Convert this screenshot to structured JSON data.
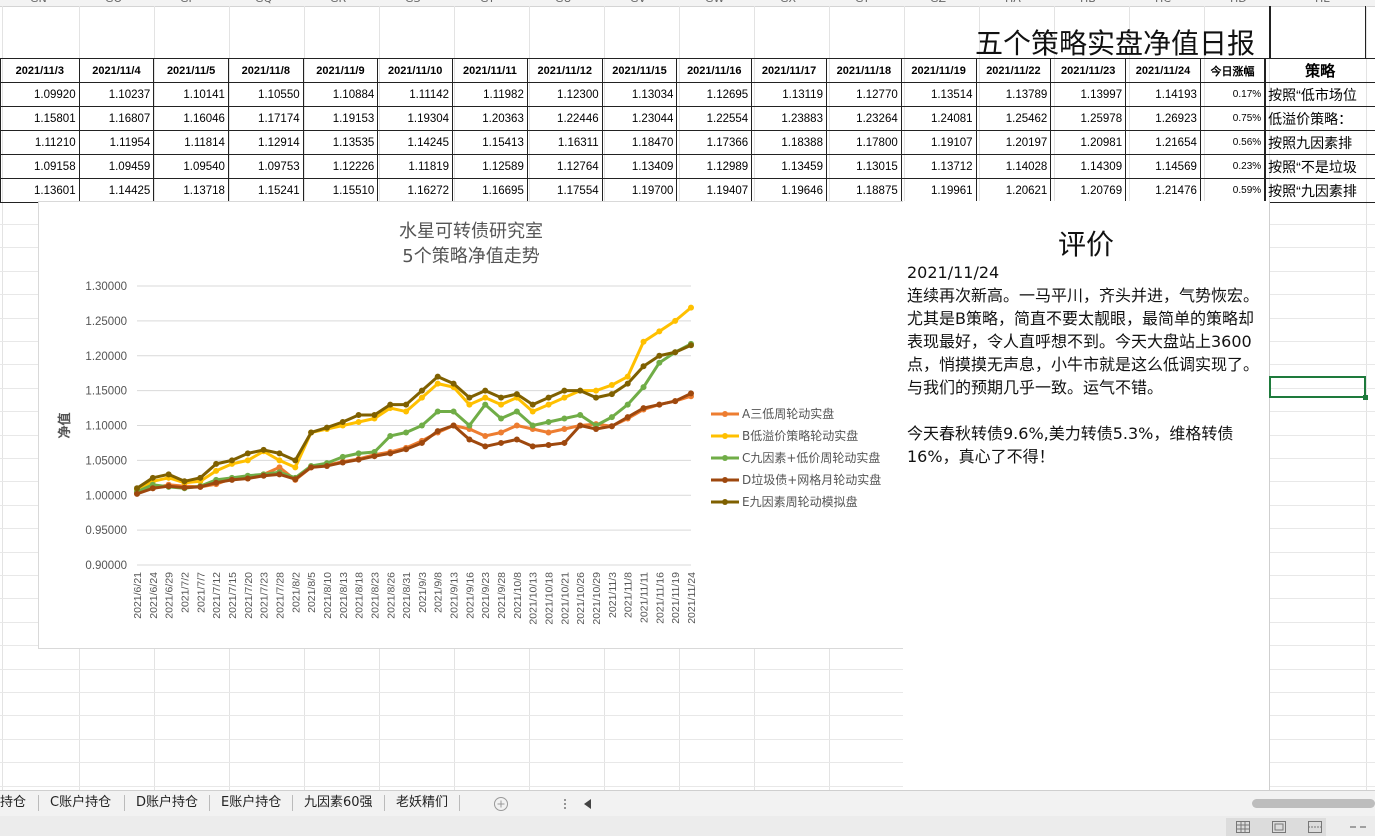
{
  "main_title": "五个策略实盘净值日报",
  "table": {
    "headers": [
      "2021/11/3",
      "2021/11/4",
      "2021/11/5",
      "2021/11/8",
      "2021/11/9",
      "2021/11/10",
      "2021/11/11",
      "2021/11/12",
      "2021/11/15",
      "2021/11/16",
      "2021/11/17",
      "2021/11/18",
      "2021/11/19",
      "2021/11/22",
      "2021/11/23",
      "2021/11/24",
      "今日涨幅",
      "策略"
    ],
    "rows": [
      [
        "1.09920",
        "1.10237",
        "1.10141",
        "1.10550",
        "1.10884",
        "1.11142",
        "1.11982",
        "1.12300",
        "1.13034",
        "1.12695",
        "1.13119",
        "1.12770",
        "1.13514",
        "1.13789",
        "1.13997",
        "1.14193",
        "0.17%",
        "按照“低市场位"
      ],
      [
        "1.15801",
        "1.16807",
        "1.16046",
        "1.17174",
        "1.19153",
        "1.19304",
        "1.20363",
        "1.22446",
        "1.23044",
        "1.22554",
        "1.23883",
        "1.23264",
        "1.24081",
        "1.25462",
        "1.25978",
        "1.26923",
        "0.75%",
        "低溢价策略："
      ],
      [
        "1.11210",
        "1.11954",
        "1.11814",
        "1.12914",
        "1.13535",
        "1.14245",
        "1.15413",
        "1.16311",
        "1.18470",
        "1.17366",
        "1.18388",
        "1.17800",
        "1.19107",
        "1.20197",
        "1.20981",
        "1.21654",
        "0.56%",
        "按照九因素排"
      ],
      [
        "1.09158",
        "1.09459",
        "1.09540",
        "1.09753",
        "1.12226",
        "1.11819",
        "1.12589",
        "1.12764",
        "1.13409",
        "1.12989",
        "1.13459",
        "1.13015",
        "1.13712",
        "1.14028",
        "1.14309",
        "1.14569",
        "0.23%",
        "按照“不是垃圾"
      ],
      [
        "1.13601",
        "1.14425",
        "1.13718",
        "1.15241",
        "1.15510",
        "1.16272",
        "1.16695",
        "1.17554",
        "1.19700",
        "1.19407",
        "1.19646",
        "1.18875",
        "1.19961",
        "1.20621",
        "1.20769",
        "1.21476",
        "0.59%",
        "按照“九因素排"
      ]
    ]
  },
  "chart_data": {
    "type": "line",
    "title": "水星可转债研究室",
    "subtitle": "5个策略净值走势",
    "ylabel": "净值",
    "ylim": [
      0.9,
      1.3
    ],
    "yticks": [
      "0.90000",
      "0.95000",
      "1.00000",
      "1.05000",
      "1.10000",
      "1.15000",
      "1.20000",
      "1.25000",
      "1.30000"
    ],
    "xtick_labels": [
      "2021/6/21",
      "2021/6/24",
      "2021/6/29",
      "2021/7/2",
      "2021/7/7",
      "2021/7/12",
      "2021/7/15",
      "2021/7/20",
      "2021/7/23",
      "2021/7/28",
      "2021/8/2",
      "2021/8/5",
      "2021/8/10",
      "2021/8/13",
      "2021/8/18",
      "2021/8/23",
      "2021/8/26",
      "2021/8/31",
      "2021/9/3",
      "2021/9/8",
      "2021/9/13",
      "2021/9/16",
      "2021/9/23",
      "2021/9/28",
      "2021/10/8",
      "2021/10/13",
      "2021/10/18",
      "2021/10/21",
      "2021/10/26",
      "2021/10/29",
      "2021/11/3",
      "2021/11/8",
      "2021/11/11",
      "2021/11/16",
      "2021/11/19",
      "2021/11/24"
    ],
    "legend_position": "right",
    "grid": true,
    "series": [
      {
        "name": "A三低周轮动实盘",
        "color": "#ed7d31",
        "values": [
          1.003,
          1.01,
          1.015,
          1.013,
          1.012,
          1.016,
          1.024,
          1.024,
          1.03,
          1.04,
          1.022,
          1.04,
          1.043,
          1.048,
          1.052,
          1.058,
          1.062,
          1.068,
          1.078,
          1.09,
          1.1,
          1.095,
          1.085,
          1.09,
          1.1,
          1.095,
          1.09,
          1.095,
          1.1,
          1.102,
          1.099,
          1.11,
          1.123,
          1.13,
          1.135,
          1.142
        ]
      },
      {
        "name": "B低溢价策略轮动实盘",
        "color": "#ffc000",
        "values": [
          1.008,
          1.02,
          1.025,
          1.018,
          1.02,
          1.035,
          1.045,
          1.05,
          1.063,
          1.05,
          1.04,
          1.09,
          1.095,
          1.1,
          1.105,
          1.11,
          1.125,
          1.12,
          1.14,
          1.16,
          1.155,
          1.13,
          1.14,
          1.13,
          1.14,
          1.12,
          1.13,
          1.14,
          1.15,
          1.15,
          1.158,
          1.17,
          1.22,
          1.235,
          1.25,
          1.269
        ]
      },
      {
        "name": "C九因素+低价周轮动实盘",
        "color": "#70ad47",
        "values": [
          1.005,
          1.015,
          1.012,
          1.01,
          1.013,
          1.022,
          1.025,
          1.028,
          1.03,
          1.033,
          1.025,
          1.042,
          1.046,
          1.055,
          1.06,
          1.062,
          1.085,
          1.09,
          1.1,
          1.12,
          1.12,
          1.1,
          1.13,
          1.11,
          1.12,
          1.1,
          1.105,
          1.11,
          1.115,
          1.1,
          1.112,
          1.13,
          1.155,
          1.19,
          1.205,
          1.217
        ]
      },
      {
        "name": "D垃圾债+网格月轮动实盘",
        "color": "#9e480e",
        "values": [
          1.002,
          1.01,
          1.013,
          1.011,
          1.012,
          1.018,
          1.022,
          1.024,
          1.028,
          1.03,
          1.023,
          1.04,
          1.042,
          1.047,
          1.051,
          1.056,
          1.06,
          1.066,
          1.075,
          1.092,
          1.1,
          1.08,
          1.07,
          1.075,
          1.08,
          1.07,
          1.072,
          1.075,
          1.1,
          1.095,
          1.099,
          1.112,
          1.125,
          1.13,
          1.135,
          1.146
        ]
      },
      {
        "name": "E九因素周轮动模拟盘",
        "color": "#7f6000",
        "values": [
          1.01,
          1.025,
          1.03,
          1.02,
          1.025,
          1.045,
          1.05,
          1.06,
          1.065,
          1.06,
          1.05,
          1.09,
          1.097,
          1.105,
          1.115,
          1.115,
          1.13,
          1.13,
          1.15,
          1.17,
          1.16,
          1.14,
          1.15,
          1.14,
          1.145,
          1.13,
          1.14,
          1.15,
          1.15,
          1.14,
          1.145,
          1.16,
          1.185,
          1.2,
          1.205,
          1.215
        ]
      }
    ]
  },
  "evaluation": {
    "title": "评价",
    "date": "2021/11/24",
    "body": "连续再次新高。一马平川，齐头并进，气势恢宏。尤其是B策略，简直不要太靓眼，最简单的策略却表现最好，令人直呼想不到。今天大盘站上3600点，悄摸摸无声息，小牛市就是这么低调实现了。与我们的预期几乎一致。运气不错。\n\n今天春秋转债9.6%,美力转债5.3%，维格转债16%，真心了不得！"
  },
  "column_headers": [
    "GN",
    "GO",
    "GP",
    "GQ",
    "GR",
    "GS",
    "GT",
    "GU",
    "GV",
    "GW",
    "GX",
    "GY",
    "GZ",
    "HA",
    "HB",
    "HC",
    "HD",
    "HE"
  ],
  "sheet_tabs": [
    "持仓",
    "C账户持仓",
    "D账户持仓",
    "E账户持仓",
    "九因素60强",
    "老妖精们"
  ],
  "add_sheet_icon": "plus-circle-icon",
  "more_icon": "vertical-ellipsis-icon",
  "scroll_left_icon": "triangle-left-icon"
}
